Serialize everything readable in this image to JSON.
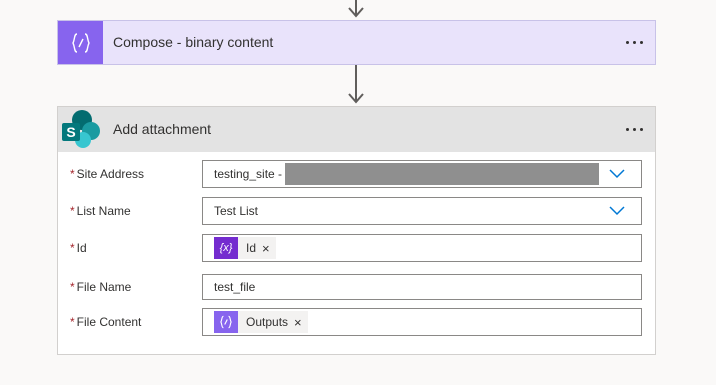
{
  "compose": {
    "title": "Compose - binary content",
    "icon": "curly-braces-icon",
    "accent": "#8764ee"
  },
  "attachment": {
    "title": "Add attachment",
    "icon": "sharepoint-icon",
    "fields": {
      "site_address": {
        "label": "Site Address",
        "value": "testing_site -"
      },
      "list_name": {
        "label": "List Name",
        "value": "Test List"
      },
      "id": {
        "label": "Id",
        "token": "Id",
        "token_icon": "expression-icon",
        "token_color": "#742ccf"
      },
      "file_name": {
        "label": "File Name",
        "value": "test_file"
      },
      "file_content": {
        "label": "File Content",
        "token": "Outputs",
        "token_icon": "curly-braces-icon",
        "token_color": "#8764ee"
      }
    },
    "required_marker": "*",
    "token_remove": "×"
  }
}
